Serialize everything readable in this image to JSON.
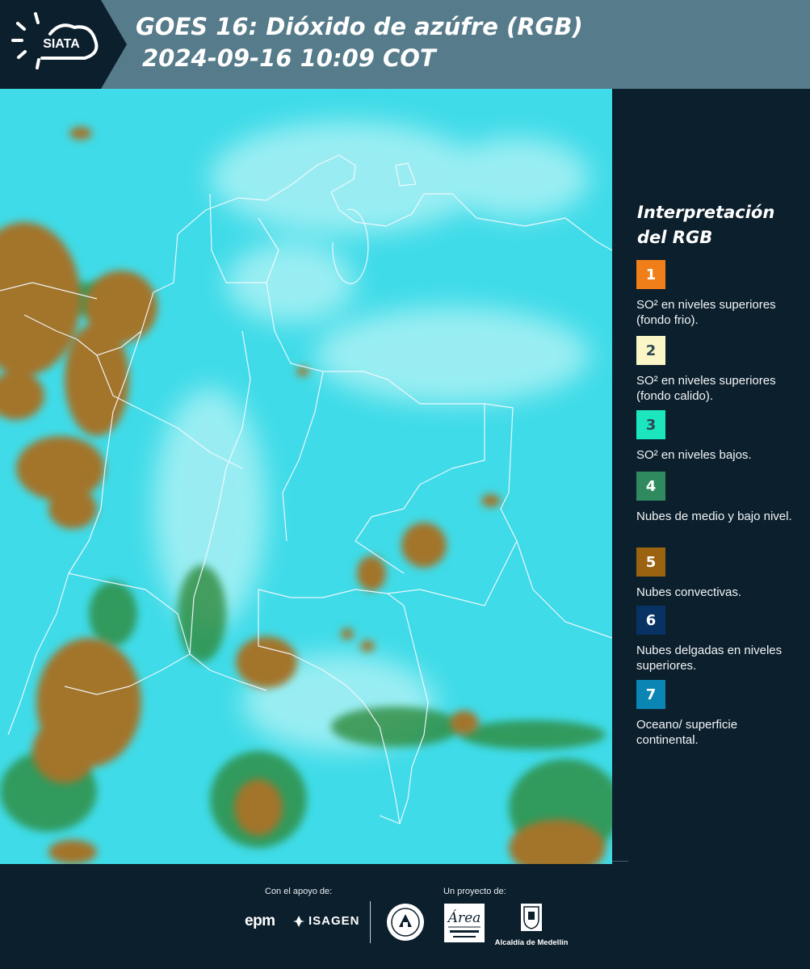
{
  "header": {
    "logo_text": "SIATA",
    "title_line1": "GOES 16: Dióxido de azúfre (RGB)",
    "title_line2": "2024-09-16 10:09 COT"
  },
  "legend": {
    "title_line1": "Interpretación",
    "title_line2": "del RGB",
    "items": [
      {
        "number": "1",
        "color": "#f07f1a",
        "label": "SO² en niveles superiores (fondo frio)."
      },
      {
        "number": "2",
        "color": "#fbf6c7",
        "label": "SO² en niveles superiores (fondo calido)."
      },
      {
        "number": "3",
        "color": "#1ce6bd",
        "label": "SO² en niveles bajos."
      },
      {
        "number": "4",
        "color": "#2f8a60",
        "label": "Nubes de medio y bajo nivel."
      },
      {
        "number": "5",
        "color": "#9b6210",
        "label": "Nubes convectivas."
      },
      {
        "number": "6",
        "color": "#073263",
        "label": "Nubes delgadas en niveles superiores."
      },
      {
        "number": "7",
        "color": "#0b86b4",
        "label": "Oceano/ superficie continental."
      }
    ]
  },
  "footer": {
    "support_label": "Con el apoyo de:",
    "project_label": "Un proyecto de:",
    "sponsors": [
      "epm",
      "ISAGEN"
    ],
    "partners": [
      "Área Metropolitana Valle de Aburrá",
      "Alcaldía de Medellín"
    ],
    "alcaldia_label": "Alcaldía de Medellín"
  },
  "map": {
    "colors": {
      "background": "#3fdbe8",
      "convective": "#a3752c",
      "low_cloud": "#2f8a3a",
      "border": "#f4f8ff"
    }
  }
}
